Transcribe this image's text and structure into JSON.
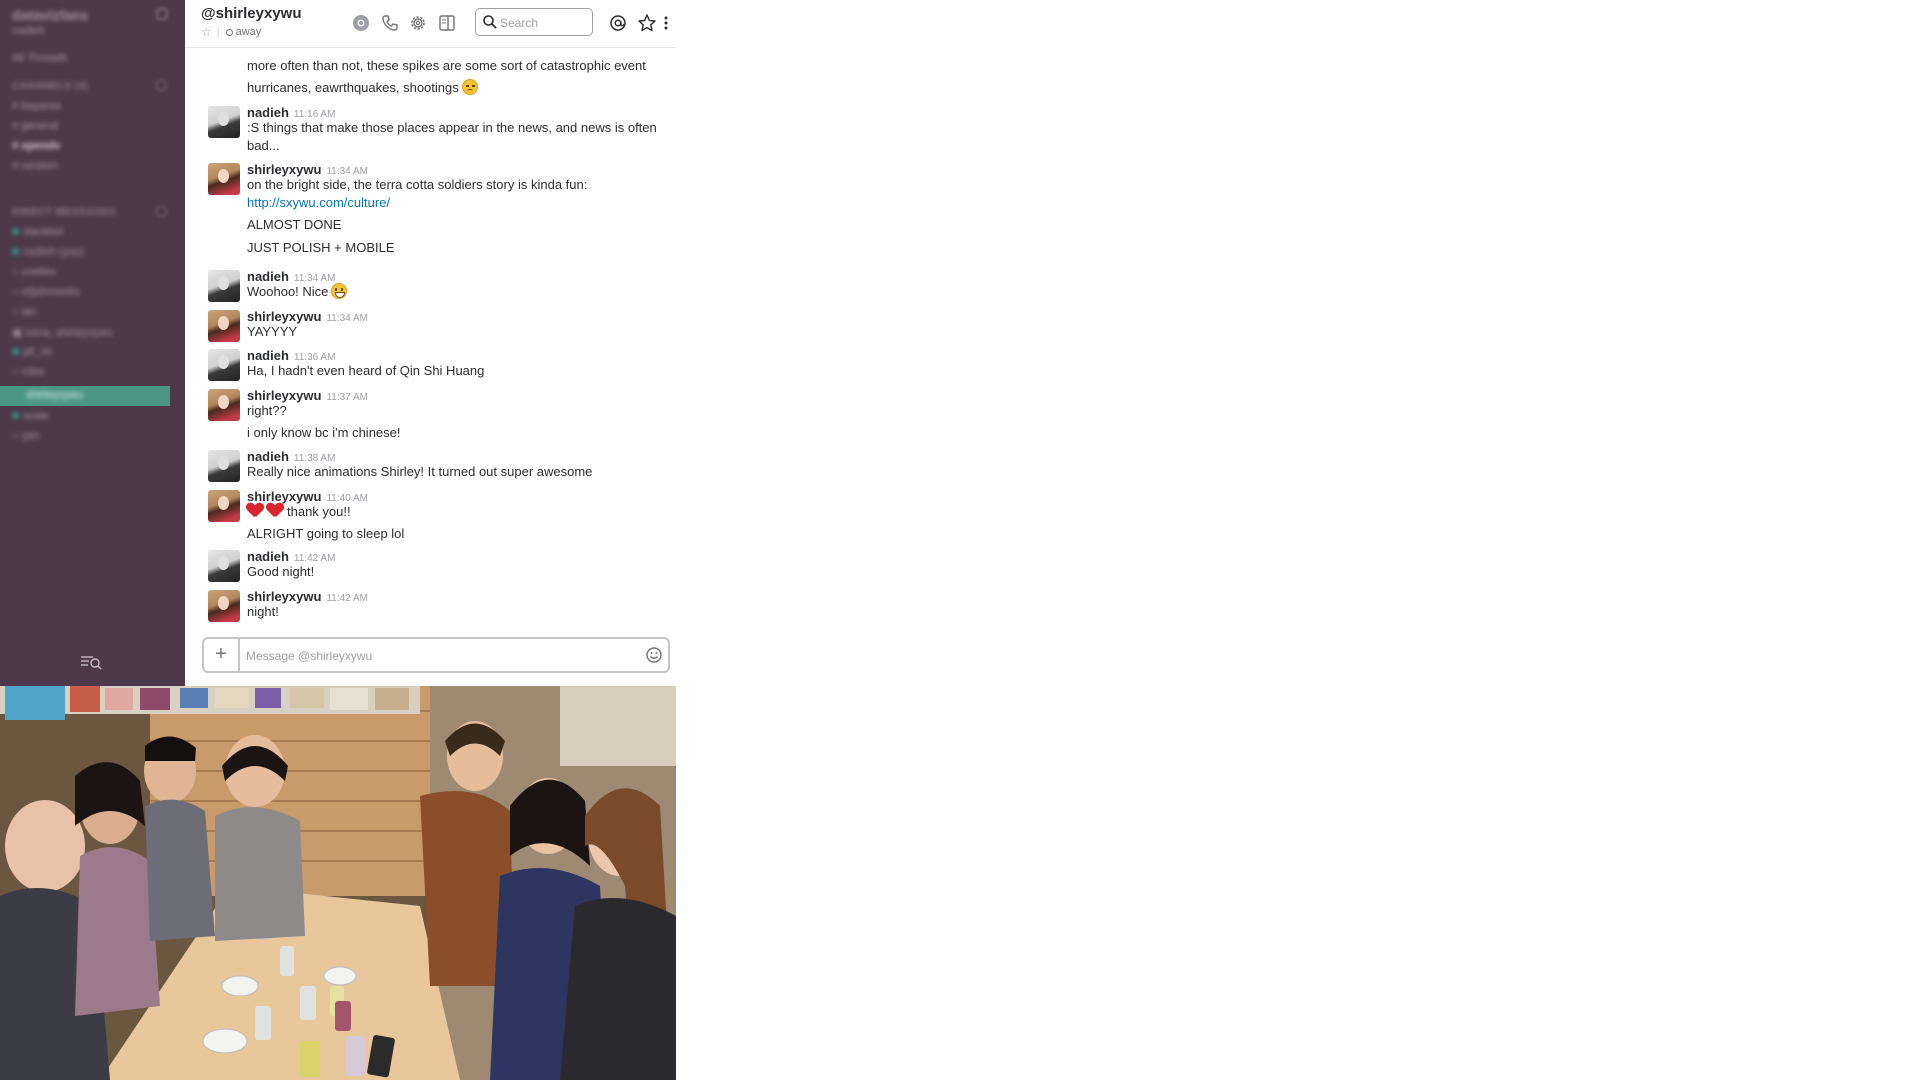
{
  "sidebar": {
    "workspace_name": "datavizfans",
    "user": "nadieh",
    "threads_label": "All Threads",
    "channels_header": "CHANNELS (4)",
    "channels": [
      "bayarea",
      "general",
      "opendv",
      "random"
    ],
    "dm_header": "DIRECT MESSAGES",
    "direct_messages": [
      "slackbot",
      "nadieh (you)",
      "cnelles",
      "elijahmeeks",
      "ian",
      "irene, shirleyxywu",
      "jdl_nb",
      "mike"
    ],
    "active_dm": "shirleyxywu",
    "after_active": [
      "susie",
      "yan"
    ]
  },
  "header": {
    "channel_name": "@shirleyxywu",
    "presence": "away",
    "search_placeholder": "Search"
  },
  "messages": [
    {
      "lines": [
        "more often than not, these spikes are some sort of catastrophic event",
        "hurricanes, eawrthquakes, shootings"
      ]
    },
    {
      "author": "nadieh",
      "time": "11:16 AM",
      "lines": [
        ":S things that make those places appear in the news, and news is often",
        "bad..."
      ]
    },
    {
      "author": "shirleyxywu",
      "time": "11:34 AM",
      "lines": [
        "on the bright side, the terra cotta soldiers story is kinda fun:",
        "http://sxywu.com/culture/",
        "ALMOST DONE",
        "JUST POLISH + MOBILE"
      ]
    },
    {
      "author": "nadieh",
      "time": "11:34 AM",
      "lines": [
        "Woohoo! Nice"
      ]
    },
    {
      "author": "shirleyxywu",
      "time": "11:34 AM",
      "lines": [
        "YAYYYY"
      ]
    },
    {
      "author": "nadieh",
      "time": "11:36 AM",
      "lines": [
        "Ha, I hadn't even heard of Qin Shi Huang"
      ]
    },
    {
      "author": "shirleyxywu",
      "time": "11:37 AM",
      "lines": [
        "right??",
        "i only know bc i'm chinese!"
      ]
    },
    {
      "author": "nadieh",
      "time": "11:38 AM",
      "lines": [
        "Really nice animations Shirley! It turned out super awesome"
      ]
    },
    {
      "author": "shirleyxywu",
      "time": "11:40 AM",
      "lines": [
        "thank you!!",
        "ALRIGHT going to sleep lol"
      ]
    },
    {
      "author": "nadieh",
      "time": "11:42 AM",
      "lines": [
        "Good night!"
      ]
    },
    {
      "author": "shirleyxywu",
      "time": "11:42 AM",
      "lines": [
        "night!"
      ]
    }
  ],
  "composer": {
    "placeholder": "Message @shirleyxywu",
    "add_label": "+"
  },
  "colors": {
    "sidebar_bg": "#4d394b",
    "active_item": "#4c9689",
    "link": "#0576b9"
  }
}
